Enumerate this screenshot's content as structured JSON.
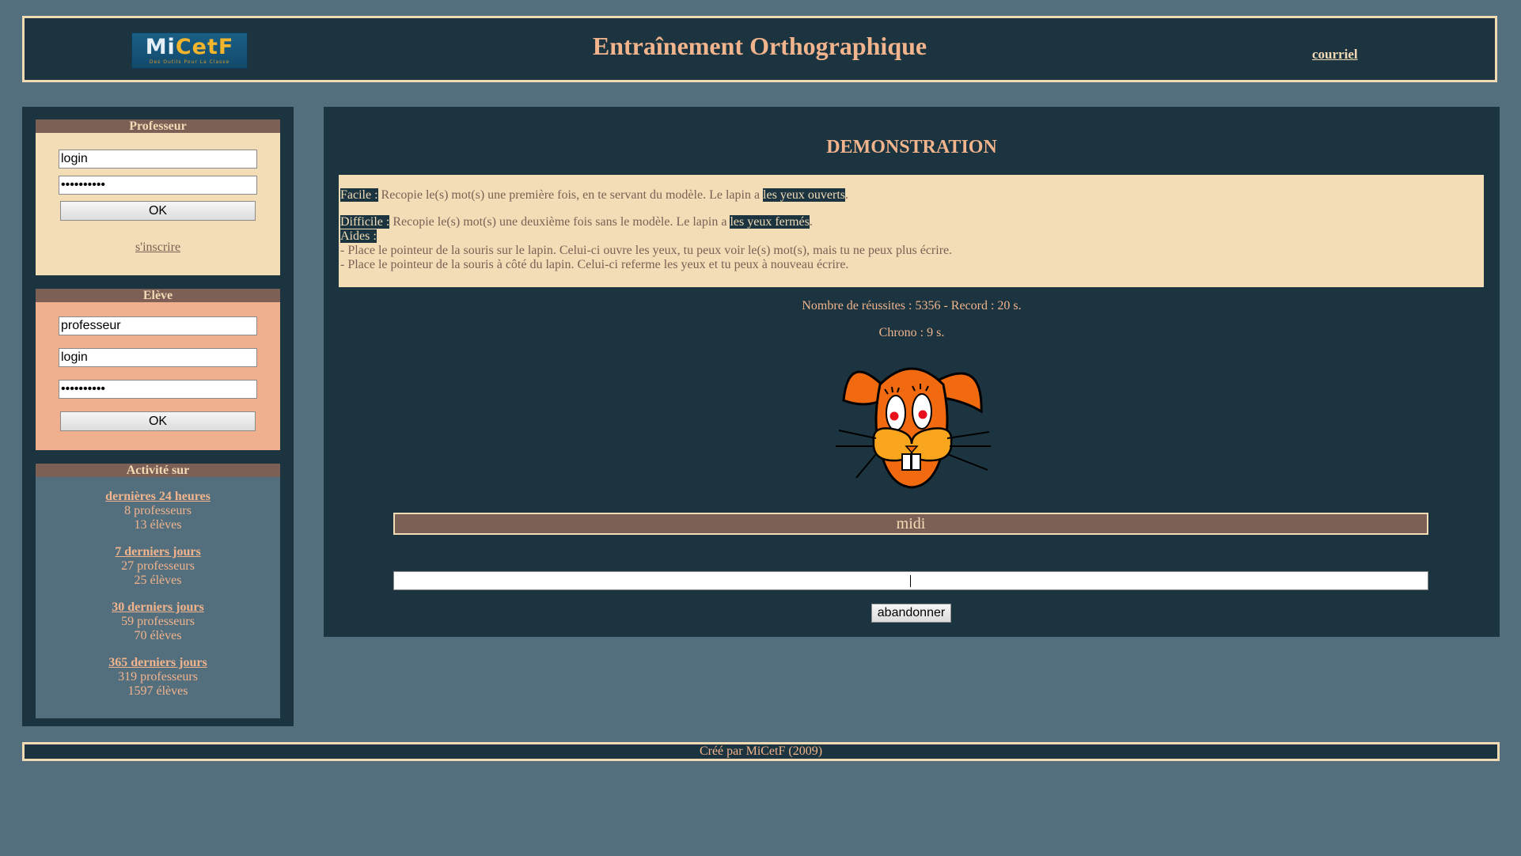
{
  "header": {
    "logo_text_left": "Mi",
    "logo_text_right": "CetF",
    "logo_tagline": "Des Outils Pour La Classe",
    "title": "Entraînement Orthographique",
    "email_link": "courriel"
  },
  "professeur": {
    "heading": "Professeur",
    "login_value": "login",
    "password_value": "••••••••••",
    "ok_label": "OK",
    "signup_link": "s'inscrire"
  },
  "eleve": {
    "heading": "Elève",
    "teacher_value": "professeur",
    "login_value": "login",
    "password_value": "••••••••••",
    "ok_label": "OK"
  },
  "activity": {
    "heading": "Activité sur",
    "groups": [
      {
        "title": "dernières 24 heures",
        "teachers": "8 professeurs",
        "students": "13 élèves"
      },
      {
        "title": "7 derniers jours",
        "teachers": "27 professeurs",
        "students": "25 élèves"
      },
      {
        "title": "30 derniers jours",
        "teachers": "59 professeurs",
        "students": "70 élèves"
      },
      {
        "title": "365 derniers jours",
        "teachers": "319 professeurs",
        "students": "1597 élèves"
      }
    ]
  },
  "main": {
    "title": "DEMONSTRATION",
    "instructions": {
      "easy_label": "Facile :",
      "easy_text": " Recopie le(s) mot(s) une première fois, en te servant du modèle. Le lapin a ",
      "easy_highlight": "les yeux ouverts",
      "easy_end": ".",
      "hard_label": "Difficile :",
      "hard_text": " Recopie le(s) mot(s) une deuxième fois sans le modèle. Le lapin a ",
      "hard_highlight": "les yeux fermés",
      "hard_end": ".",
      "help_label": "Aides :",
      "help_line1": "- Place le pointeur de la souris sur le lapin. Celui-ci ouvre les yeux, tu peux voir le(s) mot(s), mais tu ne peux plus écrire.",
      "help_line2": "- Place le pointeur de la souris à côté du lapin. Celui-ci referme les yeux et tu peux à nouveau écrire."
    },
    "stats": "Nombre de réussites : 5356 - Record : 20 s.",
    "chrono": "Chrono : 9 s.",
    "word": "midi",
    "answer_value": "",
    "give_up_label": "abandonner"
  },
  "footer": {
    "credit": "Créé par MiCetF (2009)"
  },
  "colors": {
    "background": "#536f7e",
    "dark_panel": "#1b3440",
    "accent_text": "#f2b48c",
    "cream": "#f3ddb7",
    "brown": "#7c5f55",
    "salmon": "#f1b08d"
  }
}
